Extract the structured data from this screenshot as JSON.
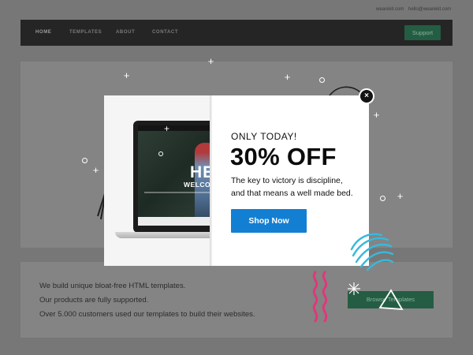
{
  "topbar": {
    "email_1": "wearekit.com",
    "email_2": "hello@wearekit.com"
  },
  "nav": {
    "items": [
      {
        "label": "HOME"
      },
      {
        "label": "TEMPLATES"
      },
      {
        "label": "ABOUT"
      },
      {
        "label": "CONTACT"
      }
    ],
    "support_label": "Support"
  },
  "feature": {
    "lines": [
      "We build unique bloat-free HTML templates.",
      "Our products are fully supported.",
      "Over 5.000 customers used our templates to build their websites."
    ],
    "browse_label": "Browse Templates"
  },
  "popup": {
    "preview": {
      "hello_text": "HEL",
      "welcome_text": "WELCOM"
    },
    "eyebrow": "ONLY TODAY!",
    "headline": "30% OFF",
    "body_lines": [
      "The key to victory is discipline,",
      "and that means a well made bed."
    ],
    "cta_label": "Shop Now",
    "close_label": "×"
  },
  "colors": {
    "overlay": "#777777",
    "cta": "#137fd3",
    "nav_bg": "#252525",
    "accent_green": "#245d43",
    "squiggle_pink": "#e3367a",
    "scribble_blue": "#37b9dc"
  }
}
